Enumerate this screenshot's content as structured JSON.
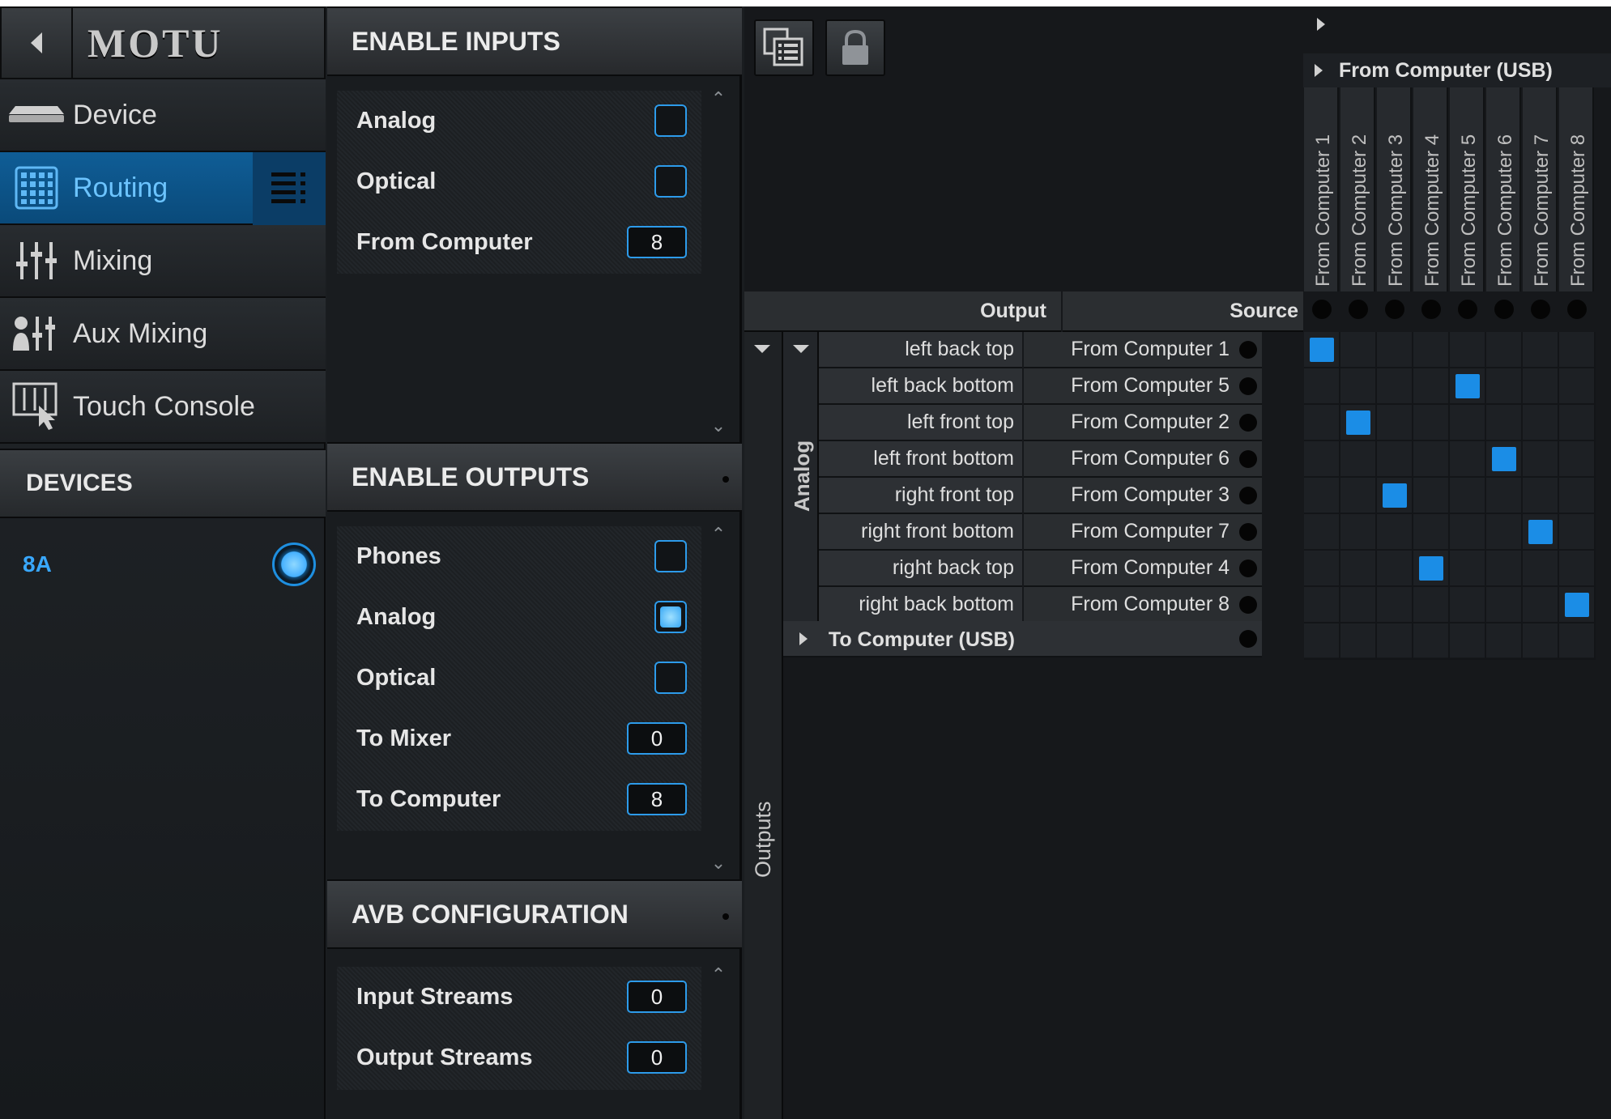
{
  "app": {
    "logo_text": "MOTU"
  },
  "nav": {
    "items": [
      {
        "label": "Device",
        "icon": "device-icon",
        "active": false
      },
      {
        "label": "Routing",
        "icon": "routing-grid-icon",
        "active": true
      },
      {
        "label": "Mixing",
        "icon": "mixer-faders-icon",
        "active": false
      },
      {
        "label": "Aux Mixing",
        "icon": "aux-mixing-icon",
        "active": false
      },
      {
        "label": "Touch Console",
        "icon": "touch-console-icon",
        "active": false
      }
    ],
    "devices_header": "DEVICES",
    "devices": [
      {
        "name": "8A",
        "selected": true
      }
    ]
  },
  "settings": {
    "enable_inputs": {
      "title": "ENABLE INPUTS",
      "rows": [
        {
          "label": "Analog",
          "type": "checkbox",
          "checked": false
        },
        {
          "label": "Optical",
          "type": "checkbox",
          "checked": false
        },
        {
          "label": "From Computer",
          "type": "number",
          "value": "8"
        }
      ]
    },
    "enable_outputs": {
      "title": "ENABLE OUTPUTS",
      "rows": [
        {
          "label": "Phones",
          "type": "checkbox",
          "checked": false
        },
        {
          "label": "Analog",
          "type": "checkbox",
          "checked": true
        },
        {
          "label": "Optical",
          "type": "checkbox",
          "checked": false
        },
        {
          "label": "To Mixer",
          "type": "number",
          "value": "0"
        },
        {
          "label": "To Computer",
          "type": "number",
          "value": "8"
        }
      ]
    },
    "avb_configuration": {
      "title": "AVB CONFIGURATION",
      "rows": [
        {
          "label": "Input Streams",
          "type": "number",
          "value": "0"
        },
        {
          "label": "Output Streams",
          "type": "number",
          "value": "0"
        }
      ]
    }
  },
  "routing": {
    "output_col_header": "Output",
    "source_col_header": "Source",
    "outputs_band_label": "Outputs",
    "analog_group_label": "Analog",
    "source_group": "From Computer (USB)",
    "source_channels": [
      "From Computer 1",
      "From Computer 2",
      "From Computer 3",
      "From Computer 4",
      "From Computer 5",
      "From Computer 6",
      "From Computer 7",
      "From Computer 8"
    ],
    "rows": [
      {
        "output": "left back top",
        "source": "From Computer 1",
        "route_col": 0
      },
      {
        "output": "left back bottom",
        "source": "From Computer 5",
        "route_col": 4
      },
      {
        "output": "left front top",
        "source": "From Computer 2",
        "route_col": 1
      },
      {
        "output": "left front bottom",
        "source": "From Computer 6",
        "route_col": 5
      },
      {
        "output": "right front top",
        "source": "From Computer 3",
        "route_col": 2
      },
      {
        "output": "right front bottom",
        "source": "From Computer 7",
        "route_col": 6
      },
      {
        "output": "right back top",
        "source": "From Computer 4",
        "route_col": 3
      },
      {
        "output": "right back bottom",
        "source": "From Computer 8",
        "route_col": 7
      }
    ],
    "collapsed_group": "To Computer (USB)",
    "colors": {
      "accent": "#1b8de6",
      "active_nav": "#0f5d96"
    }
  }
}
